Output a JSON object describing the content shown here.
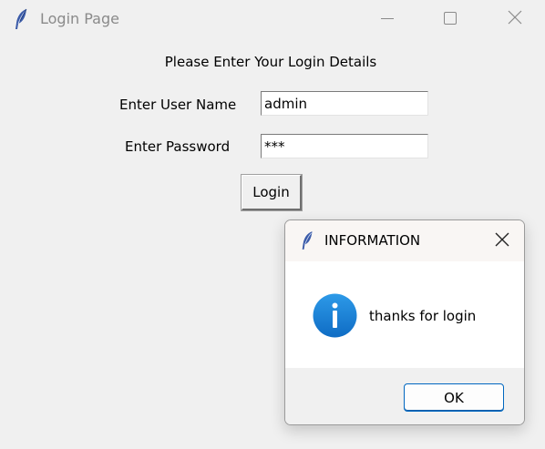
{
  "window": {
    "title": "Login Page",
    "icon": "feather-icon"
  },
  "form": {
    "heading": "Please Enter Your Login Details",
    "username_label": "Enter User Name",
    "username_value": "admin",
    "password_label": "Enter Password",
    "password_value": "***",
    "login_label": "Login"
  },
  "dialog": {
    "title": "INFORMATION",
    "icon": "info-icon",
    "message": "thanks for login",
    "ok_label": "OK"
  },
  "colors": {
    "background": "#f0f0f0",
    "info_blue": "#1a7fd4",
    "ok_border": "#0067c0"
  }
}
